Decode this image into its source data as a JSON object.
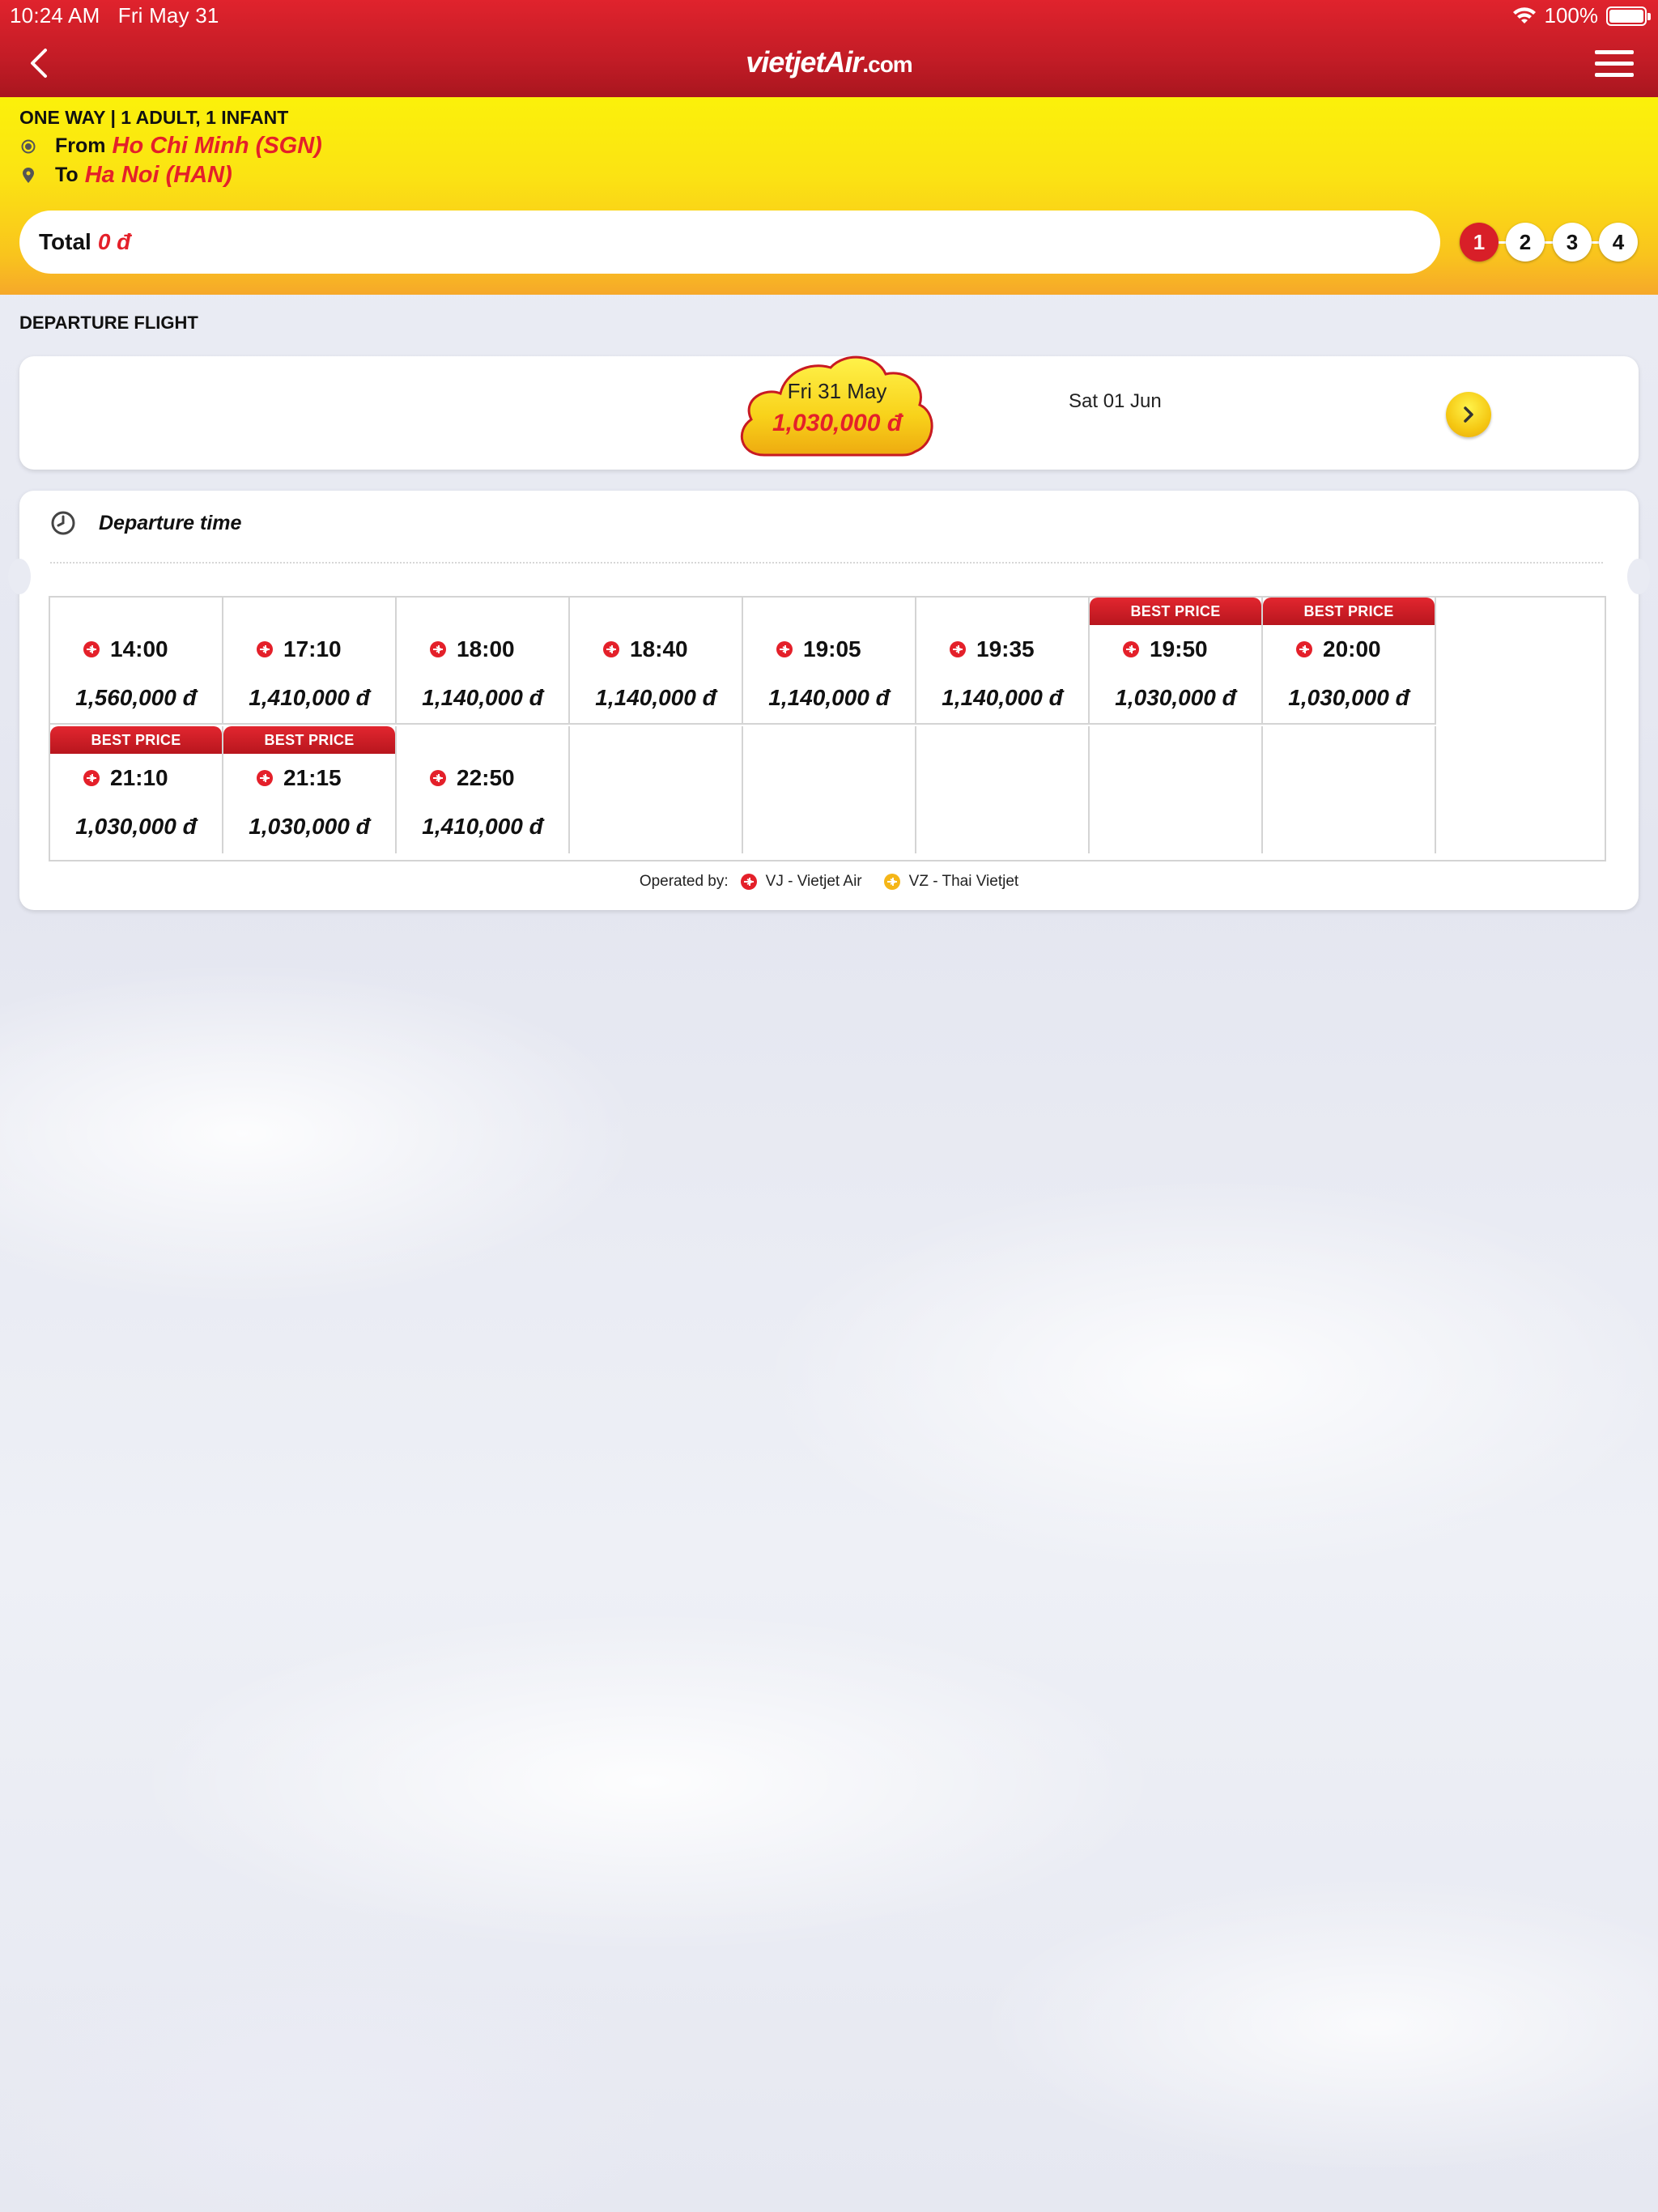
{
  "status_bar": {
    "time": "10:24 AM",
    "date": "Fri May 31",
    "battery": "100%"
  },
  "nav": {
    "logo_main": "vietjetAir",
    "logo_domain": ".com",
    "back_icon": "chevron-left-icon",
    "menu_icon": "hamburger-icon"
  },
  "booking": {
    "trip_type": "ONE WAY | 1 ADULT, 1 INFANT",
    "from_label": "From",
    "from_value": "Ho Chi Minh (SGN)",
    "to_label": "To",
    "to_value": "Ha Noi (HAN)",
    "total_label": "Total",
    "total_value": "0 đ",
    "steps": [
      "1",
      "2",
      "3",
      "4"
    ],
    "active_step": "1"
  },
  "departure": {
    "section_title": "DEPARTURE FLIGHT",
    "selected_date": "Fri 31 May",
    "selected_price": "1,030,000 đ",
    "next_date": "Sat 01 Jun",
    "time_header": "Departure time",
    "best_price_label": "BEST PRICE",
    "flights": [
      {
        "time": "14:00",
        "price": "1,560,000 đ",
        "best": false
      },
      {
        "time": "17:10",
        "price": "1,410,000 đ",
        "best": false
      },
      {
        "time": "18:00",
        "price": "1,140,000 đ",
        "best": false
      },
      {
        "time": "18:40",
        "price": "1,140,000 đ",
        "best": false
      },
      {
        "time": "19:05",
        "price": "1,140,000 đ",
        "best": false
      },
      {
        "time": "19:35",
        "price": "1,140,000 đ",
        "best": false
      },
      {
        "time": "19:50",
        "price": "1,030,000 đ",
        "best": true
      },
      {
        "time": "20:00",
        "price": "1,030,000 đ",
        "best": true
      },
      {
        "time": "21:10",
        "price": "1,030,000 đ",
        "best": true
      },
      {
        "time": "21:15",
        "price": "1,030,000 đ",
        "best": true
      },
      {
        "time": "22:50",
        "price": "1,410,000 đ",
        "best": false
      }
    ],
    "operated_by": "Operated by:",
    "operators": [
      {
        "code": "VJ - Vietjet Air",
        "color": "#e4202a"
      },
      {
        "code": "VZ - Thai Vietjet",
        "color": "#f5b618"
      }
    ]
  },
  "colors": {
    "brand_red": "#d81f28",
    "brand_yellow": "#fbe313"
  }
}
